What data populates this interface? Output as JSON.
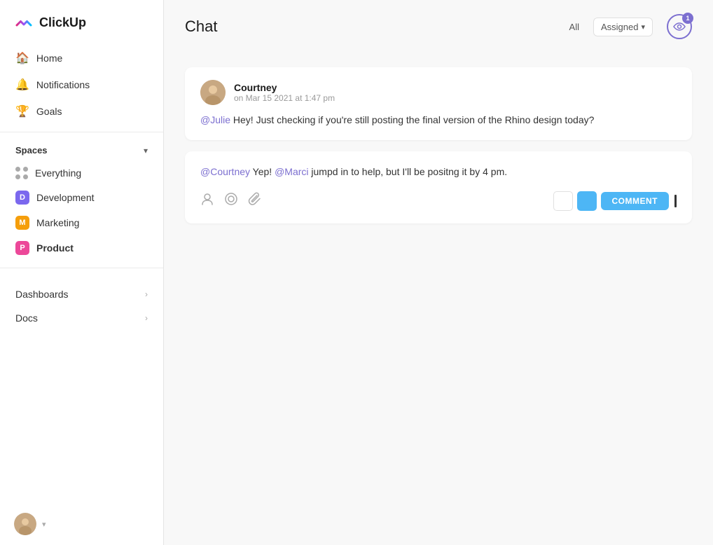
{
  "app": {
    "name": "ClickUp"
  },
  "sidebar": {
    "nav": [
      {
        "id": "home",
        "label": "Home",
        "icon": "🏠"
      },
      {
        "id": "notifications",
        "label": "Notifications",
        "icon": "🔔"
      },
      {
        "id": "goals",
        "label": "Goals",
        "icon": "🏆"
      }
    ],
    "spaces_label": "Spaces",
    "spaces": [
      {
        "id": "everything",
        "label": "Everything",
        "type": "dots"
      },
      {
        "id": "development",
        "label": "Development",
        "type": "badge",
        "letter": "D",
        "color": "blue"
      },
      {
        "id": "marketing",
        "label": "Marketing",
        "type": "badge",
        "letter": "M",
        "color": "orange"
      },
      {
        "id": "product",
        "label": "Product",
        "type": "badge",
        "letter": "P",
        "color": "pink",
        "active": true
      }
    ],
    "expandable": [
      {
        "id": "dashboards",
        "label": "Dashboards"
      },
      {
        "id": "docs",
        "label": "Docs"
      }
    ]
  },
  "chat": {
    "title": "Chat",
    "filter_all": "All",
    "filter_assigned": "Assigned",
    "eye_count": "1",
    "messages": [
      {
        "id": "msg1",
        "author": "Courtney",
        "time": "on Mar 15 2021 at 1:47 pm",
        "mention": "@Julie",
        "text": " Hey! Just checking if you're still posting the final version of the Rhino design today?"
      }
    ],
    "reply": {
      "mention1": "@Courtney",
      "text1": " Yep! ",
      "mention2": "@Marci",
      "text2": " jumpd in to help, but I'll be positng it by 4 pm."
    },
    "actions": {
      "comment_label": "COMMENT"
    }
  }
}
